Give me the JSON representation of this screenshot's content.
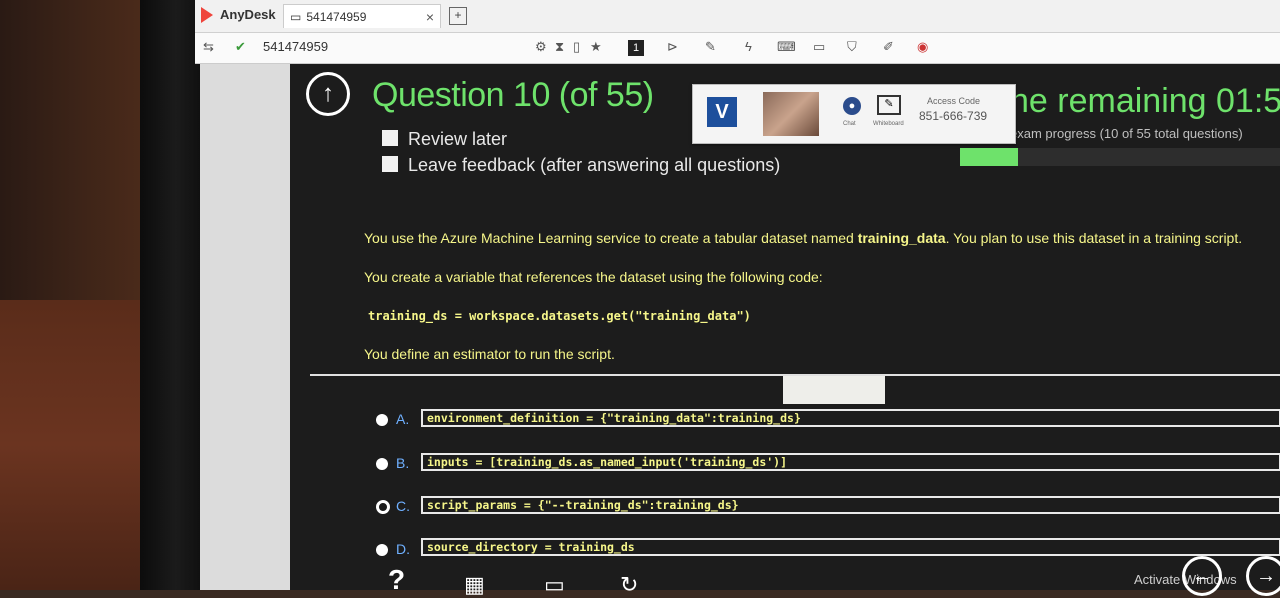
{
  "anydesk": {
    "brand": "AnyDesk",
    "tab_label": "541474959",
    "tab_close": "×",
    "new_tab": "+",
    "address": "541474959",
    "monitor_badge": "1"
  },
  "overlay": {
    "logo_letter": "V",
    "chat_label": "Chat",
    "whiteboard_label": "Whiteboard",
    "access_code_label": "Access Code",
    "access_code": "851-666-739"
  },
  "exam": {
    "question_title": "Question 10 (of 55)",
    "review_later": "Review later",
    "leave_feedback": "Leave feedback (after answering all questions)",
    "time_remaining": "he remaining  01:5",
    "progress_label": "exam progress (10 of 55 total questions)",
    "progress_fraction": 0.18,
    "para1_prefix": "You use the Azure Machine Learning service to create a tabular dataset named ",
    "para1_bold": "training_data",
    "para1_suffix": ". You plan to use this dataset in a training script.",
    "para2": "You create a variable that references the dataset using the following code:",
    "code_line": "training_ds = workspace.datasets.get(\"training_data\")",
    "para3": "You define an estimator to run the script.",
    "options": [
      {
        "letter": "A.",
        "code": "environment_definition = {\"training_data\":training_ds}"
      },
      {
        "letter": "B.",
        "code": "inputs = [training_ds.as_named_input('training_ds')]"
      },
      {
        "letter": "C.",
        "code": "script_params = {\"--training_ds\":training_ds}"
      },
      {
        "letter": "D.",
        "code": "source_directory = training_ds"
      }
    ],
    "activate_windows": "Activate Windows"
  }
}
